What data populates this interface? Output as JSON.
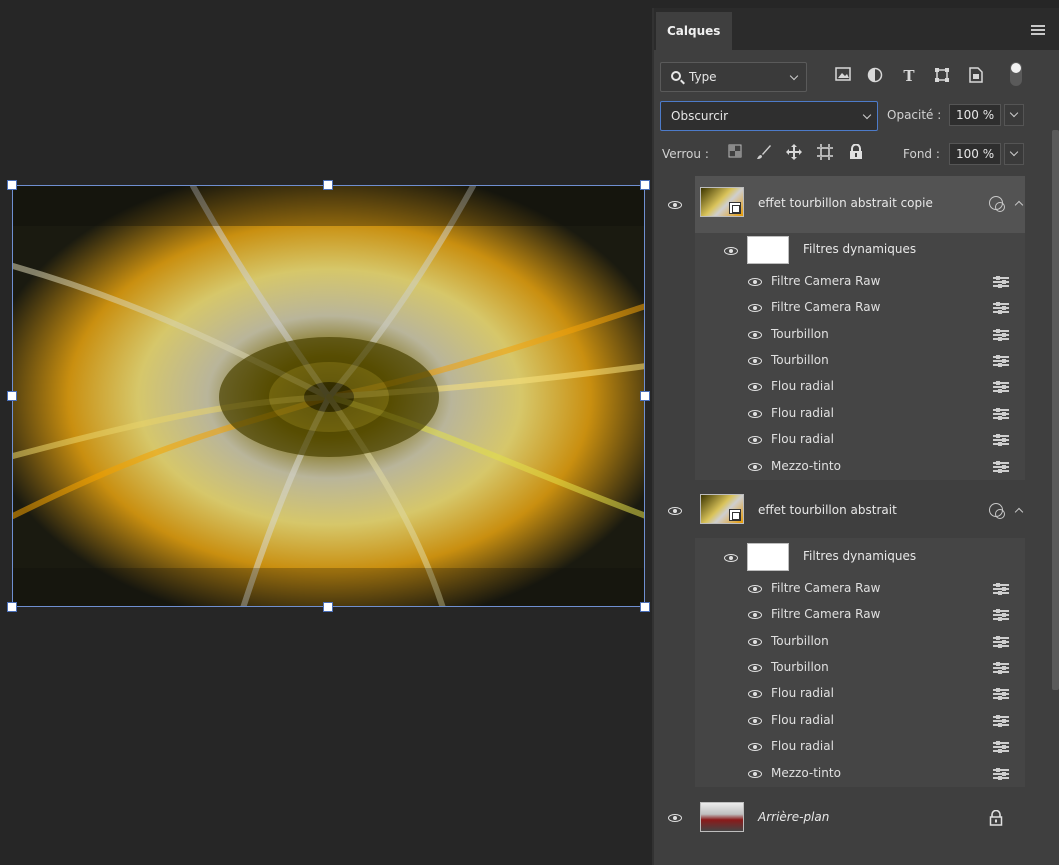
{
  "panel": {
    "tab_label": "Calques",
    "filter": {
      "label": "Type"
    },
    "blend_mode": "Obscurcir",
    "opacity": {
      "label": "Opacité :",
      "value": "100 %"
    },
    "lock": {
      "label": "Verrou :"
    },
    "fill": {
      "label": "Fond :",
      "value": "100 %"
    }
  },
  "layers": [
    {
      "name": "effet tourbillon abstrait copie",
      "smart_filters_label": "Filtres dynamiques",
      "filters": [
        "Filtre Camera Raw",
        "Filtre Camera Raw",
        "Tourbillon",
        "Tourbillon",
        "Flou radial",
        "Flou radial",
        "Flou radial",
        "Mezzo-tinto"
      ]
    },
    {
      "name": "effet tourbillon abstrait",
      "smart_filters_label": "Filtres dynamiques",
      "filters": [
        "Filtre Camera Raw",
        "Filtre Camera Raw",
        "Tourbillon",
        "Tourbillon",
        "Flou radial",
        "Flou radial",
        "Flou radial",
        "Mezzo-tinto"
      ]
    },
    {
      "name": "Arrière-plan"
    }
  ],
  "icons": {
    "filter": "search-icon",
    "filter_kinds": [
      "image-icon",
      "adjustment-icon",
      "text-icon",
      "shape-icon",
      "smart-object-icon"
    ],
    "locks": [
      "lock-transparency-icon",
      "lock-paint-icon",
      "lock-position-icon",
      "lock-artboard-icon",
      "lock-all-icon"
    ]
  },
  "colors": {
    "canvas_bg": "#262626",
    "panel_bg": "#3f3f3f",
    "selected_layer": "#535353",
    "accent": "#4d7bc9"
  }
}
